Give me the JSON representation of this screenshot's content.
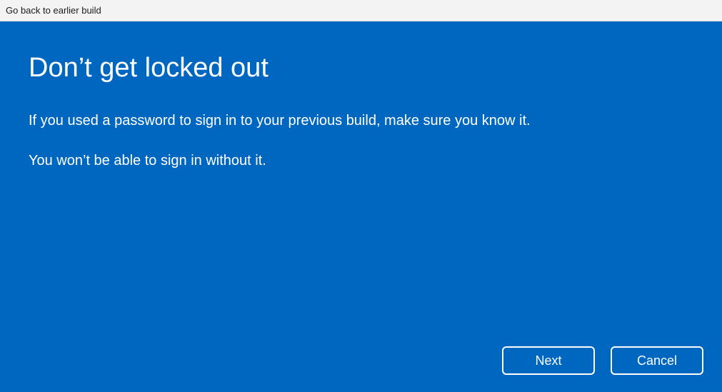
{
  "window": {
    "title": "Go back to earlier build"
  },
  "main": {
    "heading": "Don’t get locked out",
    "paragraph1": "If you used a password to sign in to your previous build, make sure you know it.",
    "paragraph2": "You won’t be able to sign in without it."
  },
  "buttons": {
    "next": "Next",
    "cancel": "Cancel"
  },
  "colors": {
    "accent": "#0067C0",
    "titlebar_bg": "#f3f3f3",
    "text_on_accent": "#ffffff"
  }
}
